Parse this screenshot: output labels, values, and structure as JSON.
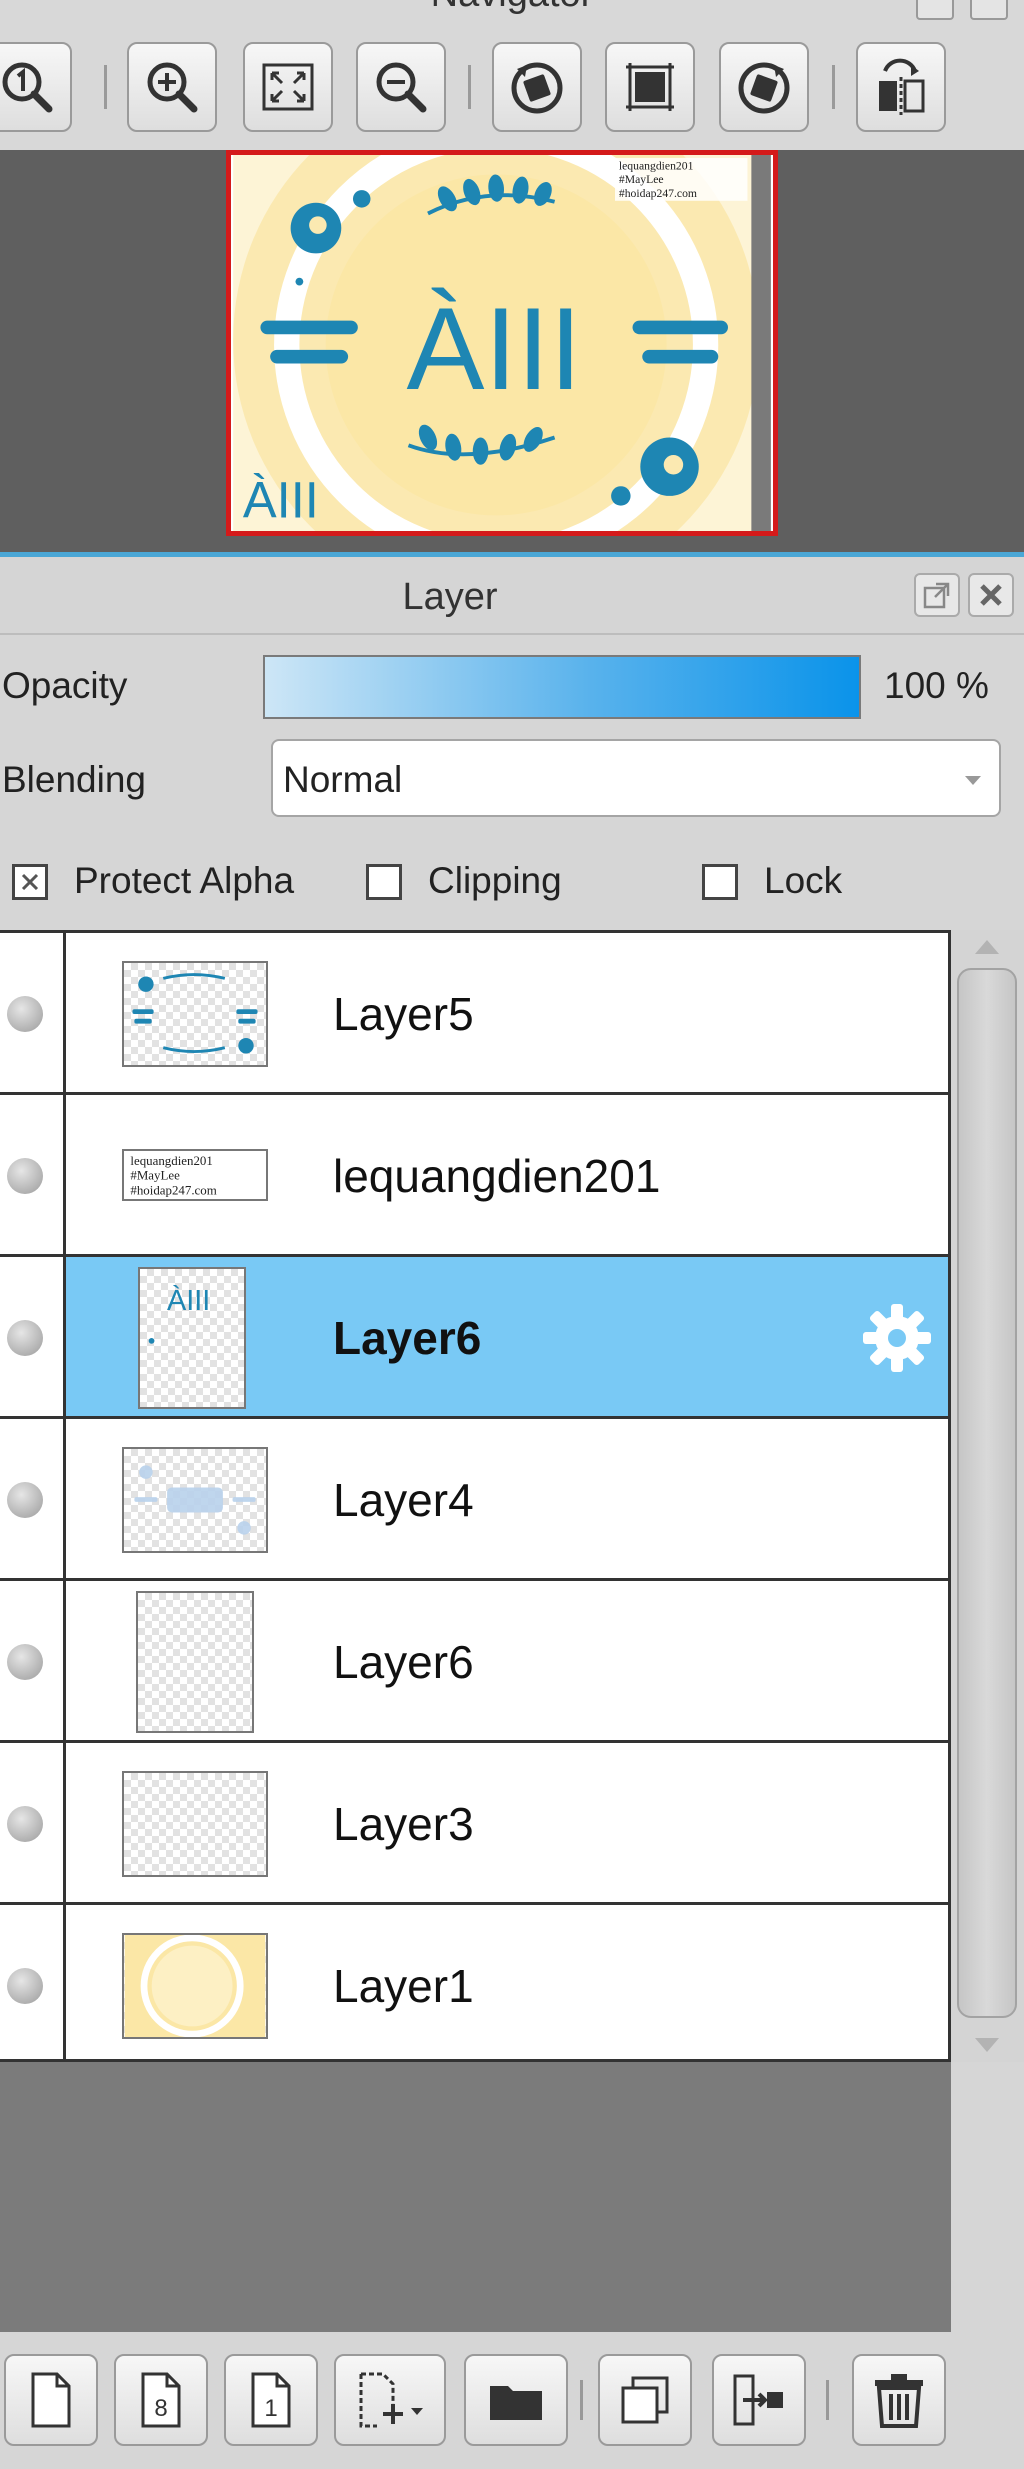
{
  "navigator": {
    "title": "Navigator",
    "tools": [
      {
        "name": "zoom-actual-size",
        "icon": "magnifier-1-icon"
      },
      {
        "name": "zoom-in",
        "icon": "magnifier-plus-icon"
      },
      {
        "name": "fit-to-window",
        "icon": "fit-screen-icon"
      },
      {
        "name": "zoom-out",
        "icon": "magnifier-minus-icon"
      },
      {
        "name": "rotate-left",
        "icon": "rotate-left-icon"
      },
      {
        "name": "reset-view",
        "icon": "reset-view-icon"
      },
      {
        "name": "rotate-right",
        "icon": "rotate-right-icon"
      },
      {
        "name": "flip-horizontal",
        "icon": "flip-horizontal-icon"
      }
    ],
    "preview": {
      "main_text": "ÀIII",
      "small_text": "ÀIII",
      "watermark_lines": [
        "lequangdien201",
        "#MayLee",
        "#hoidap247.com"
      ]
    }
  },
  "layer_panel": {
    "title": "Layer",
    "opacity_label": "Opacity",
    "opacity_value": "100 %",
    "opacity_fraction": 1.0,
    "blending_label": "Blending",
    "blending_value": "Normal",
    "checkboxes": {
      "protect_alpha": {
        "label": "Protect Alpha",
        "checked": true
      },
      "clipping": {
        "label": "Clipping",
        "checked": false
      },
      "lock": {
        "label": "Lock",
        "checked": false
      }
    },
    "layers": [
      {
        "name": "Layer5",
        "selected": false,
        "thumb": "ornaments"
      },
      {
        "name": "lequangdien201",
        "selected": false,
        "thumb": "text"
      },
      {
        "name": "Layer6",
        "selected": true,
        "thumb": "aiii"
      },
      {
        "name": "Layer4",
        "selected": false,
        "thumb": "faint"
      },
      {
        "name": "Layer6",
        "selected": false,
        "thumb": "blank-portrait"
      },
      {
        "name": "Layer3",
        "selected": false,
        "thumb": "blank"
      },
      {
        "name": "Layer1",
        "selected": false,
        "thumb": "yellow"
      }
    ],
    "thumb_text_lines": [
      "lequangdien201",
      "#MayLee",
      "#hoidap247.com"
    ],
    "thumb_aiii_text": "ÀIII",
    "bottom_tools": [
      {
        "name": "new-layer",
        "icon": "new-page-icon"
      },
      {
        "name": "new-8bit-layer",
        "icon": "page-8-icon",
        "glyph": "8"
      },
      {
        "name": "new-1bit-layer",
        "icon": "page-1-icon",
        "glyph": "1"
      },
      {
        "name": "add-layer-menu",
        "icon": "add-layer-dropdown-icon"
      },
      {
        "name": "new-folder",
        "icon": "folder-icon"
      },
      {
        "name": "duplicate-layer",
        "icon": "duplicate-icon"
      },
      {
        "name": "merge-down",
        "icon": "merge-down-icon"
      },
      {
        "name": "delete-layer",
        "icon": "trash-icon"
      }
    ]
  },
  "colors": {
    "selection": "#79c9f5",
    "accent_blue": "#4aa7d6",
    "artwork_teal": "#1e86b3",
    "artwork_cream": "#fbe9b1"
  }
}
